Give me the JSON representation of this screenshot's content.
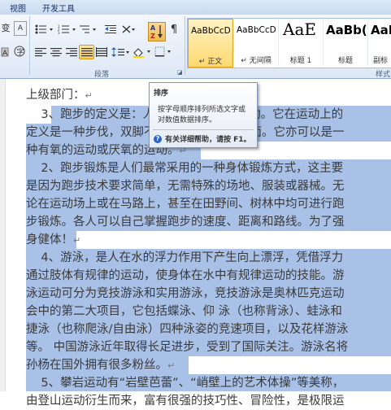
{
  "tabs": [
    "视图",
    "开发工具"
  ],
  "paragraph_group_label": "段落",
  "styles_group_label": "样式",
  "styles_gallery": [
    {
      "sample": "AaBbCcD",
      "name": "↵ 正文",
      "selected": true
    },
    {
      "sample": "AaBbCcD",
      "name": "↵ 无间隔",
      "selected": false
    },
    {
      "sample": "AaE",
      "name": "标题 1",
      "selected": false
    },
    {
      "sample": "AaBb(",
      "name": "标题",
      "selected": false
    },
    {
      "sample": "AaB",
      "name": "副标",
      "selected": false
    }
  ],
  "tooltip": {
    "title": "排序",
    "body": "按字母顺序排列所选文字或对数值数据排序。",
    "help": "有关详细帮助，请按 F1。"
  },
  "document": {
    "lines": [
      "上级部门：",
      "    3、跑步的定义是：人的两足交替向前移动。它在运动上的",
      "定义是一种步伐，双脚不会同一时间碰到地面。它亦可以是一",
      "种有氧的运动或厌氧的运动。",
      "    2、跑步锻炼是人们最常采用的一种身体锻炼方式，这主要",
      "是因为跑步技术要求简单，无需特殊的场地、服装或器械。无",
      "论在运动场上或在马路上，甚至在田野间、树林中均可进行跑",
      "步锻炼。各人可以自己掌握跑步的速度、距离和路线。为了强",
      "身健体！",
      "    4、游泳，是人在水的浮力作用下产生向上漂浮，凭借浮力",
      "通过肢体有规律的运动，使身体在水中有规律运动的技能。游",
      "泳运动可分为竞技游泳和实用游泳，竞技游泳是奥林匹克运动",
      "会中的第二大项目，它包括蝶泳、仰 泳（也称背泳）、蛙泳和",
      "捷泳（也称爬泳/自由泳）四种泳姿的竞速项目，以及花样游泳",
      "等。 中国游泳近年取得长足进步，受到了国际关注。游泳名将",
      "孙杨在国外拥有很多粉丝。",
      "    5、攀岩运动有“岩壁芭蕾”、“峭壁上的艺术体操”等美称，",
      "由登山运动衍生而来，富有很强的技巧性、冒险性，是极限运"
    ]
  },
  "colors": {
    "selection": "#a9c1e7",
    "ribbon": "#dde8f6",
    "accent": "#f7c957"
  }
}
